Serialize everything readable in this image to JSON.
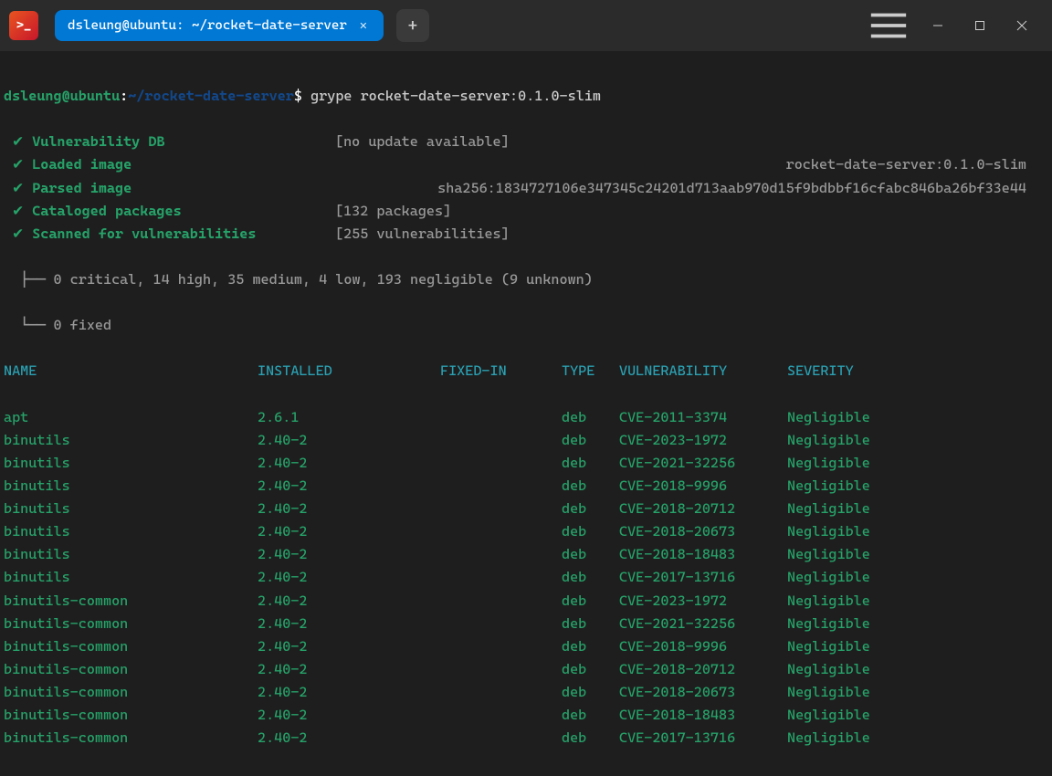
{
  "titlebar": {
    "app_icon_glyph": ">_",
    "tab_title": "dsleung@ubuntu: ~/rocket-date-server",
    "tab_close_glyph": "✕",
    "new_tab_glyph": "+"
  },
  "prompt": {
    "user_host": "dsleung@ubuntu",
    "colon": ":",
    "path": "~/rocket-date-server",
    "dollar": "$",
    "command": "grype rocket-date-server:0.1.0-slim"
  },
  "steps": [
    {
      "check": "✔",
      "label": "Vulnerability DB",
      "detail": "[no update available]",
      "right": ""
    },
    {
      "check": "✔",
      "label": "Loaded image",
      "detail": "",
      "right": "rocket-date-server:0.1.0-slim"
    },
    {
      "check": "✔",
      "label": "Parsed image",
      "detail": "",
      "right": "sha256:1834727106e347345c24201d713aab970d15f9bdbbf16cfabc846ba26bf33e44"
    },
    {
      "check": "✔",
      "label": "Cataloged packages",
      "detail": "[132 packages]",
      "right": ""
    },
    {
      "check": "✔",
      "label": "Scanned for vulnerabilities",
      "detail": "[255 vulnerabilities]",
      "right": ""
    }
  ],
  "summary": {
    "line1_prefix": "  ├── ",
    "line1": "0 critical, 14 high, 35 medium, 4 low, 193 negligible (9 unknown)",
    "line2_prefix": "  └── ",
    "line2": "0 fixed"
  },
  "headers": {
    "name": "NAME",
    "installed": "INSTALLED",
    "fixed": "FIXED-IN",
    "type": "TYPE",
    "vuln": "VULNERABILITY",
    "severity": "SEVERITY"
  },
  "rows": [
    {
      "name": "apt",
      "installed": "2.6.1",
      "fixed": "",
      "type": "deb",
      "vuln": "CVE-2011-3374",
      "severity": "Negligible"
    },
    {
      "name": "binutils",
      "installed": "2.40-2",
      "fixed": "",
      "type": "deb",
      "vuln": "CVE-2023-1972",
      "severity": "Negligible"
    },
    {
      "name": "binutils",
      "installed": "2.40-2",
      "fixed": "",
      "type": "deb",
      "vuln": "CVE-2021-32256",
      "severity": "Negligible"
    },
    {
      "name": "binutils",
      "installed": "2.40-2",
      "fixed": "",
      "type": "deb",
      "vuln": "CVE-2018-9996",
      "severity": "Negligible"
    },
    {
      "name": "binutils",
      "installed": "2.40-2",
      "fixed": "",
      "type": "deb",
      "vuln": "CVE-2018-20712",
      "severity": "Negligible"
    },
    {
      "name": "binutils",
      "installed": "2.40-2",
      "fixed": "",
      "type": "deb",
      "vuln": "CVE-2018-20673",
      "severity": "Negligible"
    },
    {
      "name": "binutils",
      "installed": "2.40-2",
      "fixed": "",
      "type": "deb",
      "vuln": "CVE-2018-18483",
      "severity": "Negligible"
    },
    {
      "name": "binutils",
      "installed": "2.40-2",
      "fixed": "",
      "type": "deb",
      "vuln": "CVE-2017-13716",
      "severity": "Negligible"
    },
    {
      "name": "binutils-common",
      "installed": "2.40-2",
      "fixed": "",
      "type": "deb",
      "vuln": "CVE-2023-1972",
      "severity": "Negligible"
    },
    {
      "name": "binutils-common",
      "installed": "2.40-2",
      "fixed": "",
      "type": "deb",
      "vuln": "CVE-2021-32256",
      "severity": "Negligible"
    },
    {
      "name": "binutils-common",
      "installed": "2.40-2",
      "fixed": "",
      "type": "deb",
      "vuln": "CVE-2018-9996",
      "severity": "Negligible"
    },
    {
      "name": "binutils-common",
      "installed": "2.40-2",
      "fixed": "",
      "type": "deb",
      "vuln": "CVE-2018-20712",
      "severity": "Negligible"
    },
    {
      "name": "binutils-common",
      "installed": "2.40-2",
      "fixed": "",
      "type": "deb",
      "vuln": "CVE-2018-20673",
      "severity": "Negligible"
    },
    {
      "name": "binutils-common",
      "installed": "2.40-2",
      "fixed": "",
      "type": "deb",
      "vuln": "CVE-2018-18483",
      "severity": "Negligible"
    },
    {
      "name": "binutils-common",
      "installed": "2.40-2",
      "fixed": "",
      "type": "deb",
      "vuln": "CVE-2017-13716",
      "severity": "Negligible"
    }
  ]
}
